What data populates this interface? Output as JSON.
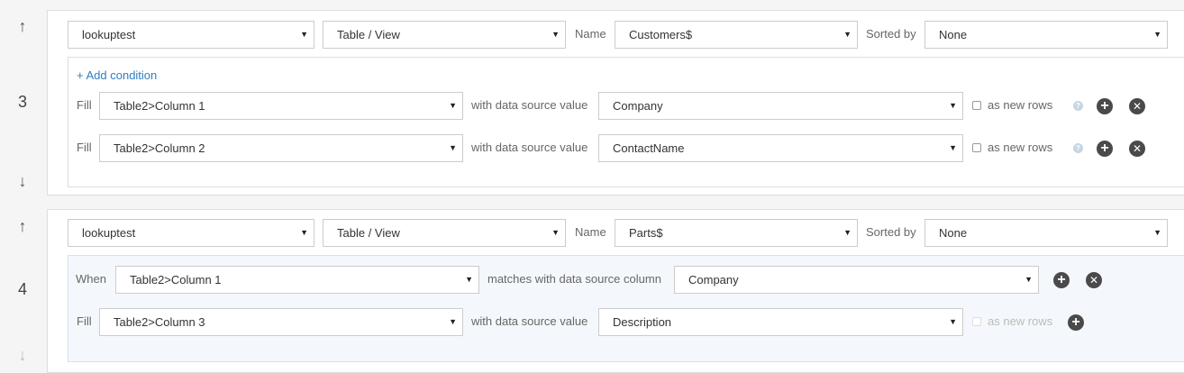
{
  "icons": {
    "up": "↑",
    "down": "↓",
    "caret": "▼",
    "plus": "+",
    "close": "✕",
    "help": "?"
  },
  "labels": {
    "name": "Name",
    "sorted_by": "Sorted by",
    "fill": "Fill",
    "when": "When",
    "with_value": "with data source value",
    "matches_column": "matches with data source column",
    "as_new_rows": "as new rows",
    "add_condition": "+ Add condition"
  },
  "steps": [
    {
      "number": "3",
      "datasource": "lookuptest",
      "source_type": "Table / View",
      "name": "Customers$",
      "sorted_by": "None",
      "rows": [
        {
          "kind": "Fill",
          "target": "Table2>Column 1",
          "value": "Company",
          "as_new_rows": false
        },
        {
          "kind": "Fill",
          "target": "Table2>Column 2",
          "value": "ContactName",
          "as_new_rows": false
        }
      ]
    },
    {
      "number": "4",
      "datasource": "lookuptest",
      "source_type": "Table / View",
      "name": "Parts$",
      "sorted_by": "None",
      "condition": {
        "kind": "When",
        "target": "Table2>Column 1",
        "value": "Company"
      },
      "rows": [
        {
          "kind": "Fill",
          "target": "Table2>Column 3",
          "value": "Description",
          "as_new_rows": false
        }
      ]
    }
  ],
  "colors": {
    "link": "#2f7fc0",
    "condition_bg": "#f4f8fc",
    "button": "#4a4a4a"
  }
}
